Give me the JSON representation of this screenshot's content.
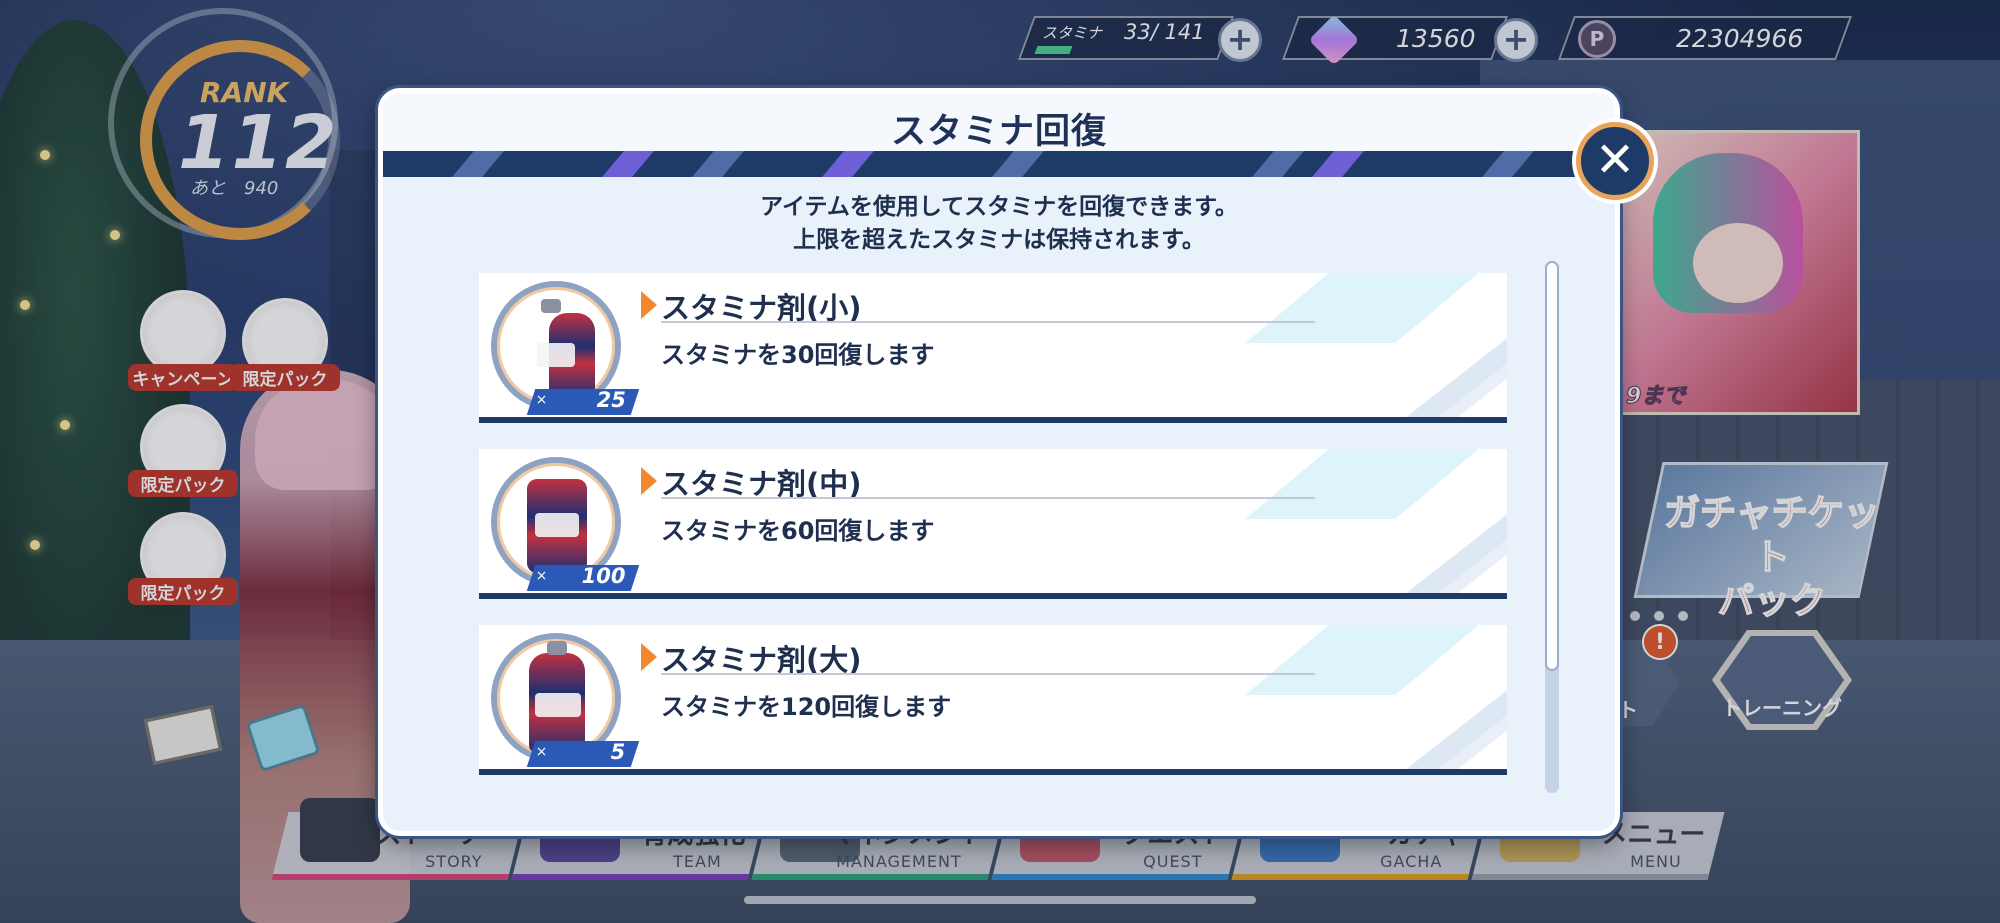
{
  "hud": {
    "stamina_label": "スタミナ",
    "stamina_value": "33/ 141",
    "stamina_current": 33,
    "stamina_max": 141,
    "gems": "13560",
    "coins": "22304966",
    "coin_icon_letter": "P"
  },
  "rank": {
    "label": "RANK",
    "value": "112",
    "next": "あと　940"
  },
  "side_menu": [
    {
      "label": "キャンペーン",
      "icon": "radish-mascot-icon"
    },
    {
      "label": "限定パック",
      "icon": "gift-pack-icon"
    },
    {
      "label": "限定パック",
      "icon": "gacha-ticket-icon"
    },
    {
      "label": "限定パック",
      "icon": "energy-drink-icon"
    }
  ],
  "banners": {
    "event_suffix": "9まで",
    "gacha_ticket_pack": [
      "ガチャチケット",
      "パック"
    ],
    "training": "トレーニング",
    "partial_button": "ト",
    "alert": "!"
  },
  "bottom_nav": [
    {
      "jp": "ストーリー",
      "en": "STORY",
      "color": "#d9487a"
    },
    {
      "jp": "育成強化",
      "en": "TEAM",
      "color": "#7a3fb8"
    },
    {
      "jp": "マネジメント",
      "en": "MANAGEMENT",
      "color": "#2fa37b"
    },
    {
      "jp": "クエスト",
      "en": "QUEST",
      "color": "#2f8fd1"
    },
    {
      "jp": "ガチャ",
      "en": "GACHA",
      "color": "#e0a020"
    },
    {
      "jp": "メニュー",
      "en": "MENU",
      "color": "#9aa1ad"
    }
  ],
  "modal": {
    "title": "スタミナ回復",
    "description": [
      "アイテムを使用してスタミナを回復できます。",
      "上限を超えたスタミナは保持されます。"
    ],
    "items": [
      {
        "name": "スタミナ剤(小)",
        "desc": "スタミナを30回復します",
        "count_prefix": "×",
        "count": "25",
        "icon": "small-bottle-icon"
      },
      {
        "name": "スタミナ剤(中)",
        "desc": "スタミナを60回復します",
        "count_prefix": "×",
        "count": "100",
        "icon": "can-icon"
      },
      {
        "name": "スタミナ剤(大)",
        "desc": "スタミナを120回復します",
        "count_prefix": "×",
        "count": "5",
        "icon": "large-bottle-icon"
      }
    ],
    "close_icon": "close-icon",
    "close_glyph": "✕"
  },
  "colors": {
    "accent_orange": "#f08a2c",
    "navy": "#1e3a66",
    "count_blue": "#2b59b8"
  }
}
